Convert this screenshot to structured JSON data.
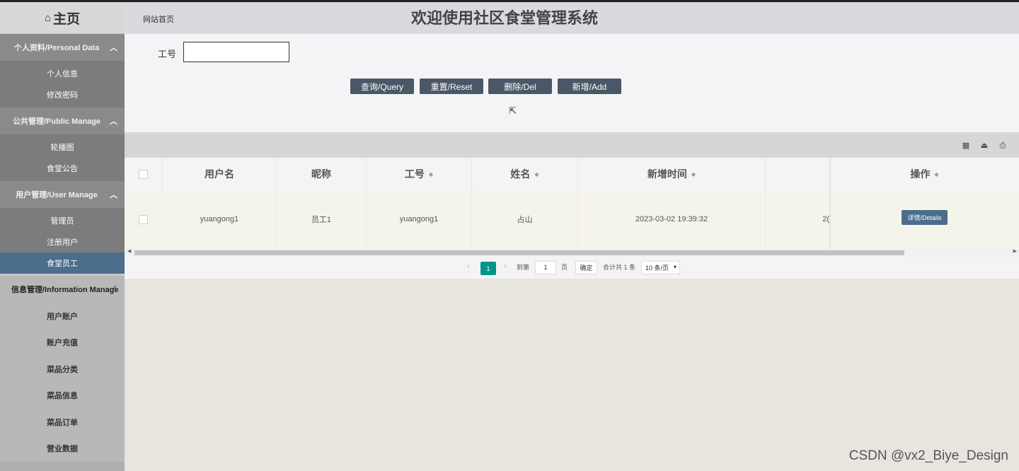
{
  "home": {
    "icon": "⌂",
    "label": "主页"
  },
  "sidebar": {
    "groups": [
      {
        "title": "个人资料/Personal Data",
        "items": [
          "个人信息",
          "修改密码"
        ]
      },
      {
        "title": "公共管理/Public Manage",
        "items": [
          "轮播图",
          "食堂公告"
        ]
      },
      {
        "title": "用户管理/User Manage",
        "items": [
          "管理员",
          "注册用户",
          "食堂员工"
        ]
      },
      {
        "title": "信息管理/Information Manage",
        "items": [
          "用户账户",
          "账户充值",
          "菜品分类",
          "菜品信息",
          "菜品订单",
          "营业数据"
        ]
      }
    ],
    "active_item": "食堂员工"
  },
  "header": {
    "breadcrumb": "网站首页",
    "title": "欢迎使用社区食堂管理系统"
  },
  "search": {
    "field_label": "工号",
    "field_value": "",
    "buttons": {
      "query": "查询/Query",
      "reset": "重置/Reset",
      "delete": "删除/Del",
      "add": "新增/Add"
    }
  },
  "toolbar": {
    "icons": [
      "columns-icon",
      "export-icon",
      "print-icon"
    ]
  },
  "table": {
    "columns": [
      "用户名",
      "昵称",
      "工号",
      "姓名",
      "新增时间",
      "操作"
    ],
    "rows": [
      {
        "username": "yuangong1",
        "nickname": "员工1",
        "job_no": "yuangong1",
        "name": "占山",
        "created": "2023-03-02 19:39:32",
        "overflow_text": "2(",
        "action": "详情/Details"
      }
    ]
  },
  "pagination": {
    "current_page": "1",
    "goto_label": "到第",
    "goto_value": "1",
    "page_unit": "页",
    "confirm": "确定",
    "total": "合计共 1 条",
    "page_size": "10 条/页"
  },
  "watermark": "CSDN @vx2_Biye_Design"
}
